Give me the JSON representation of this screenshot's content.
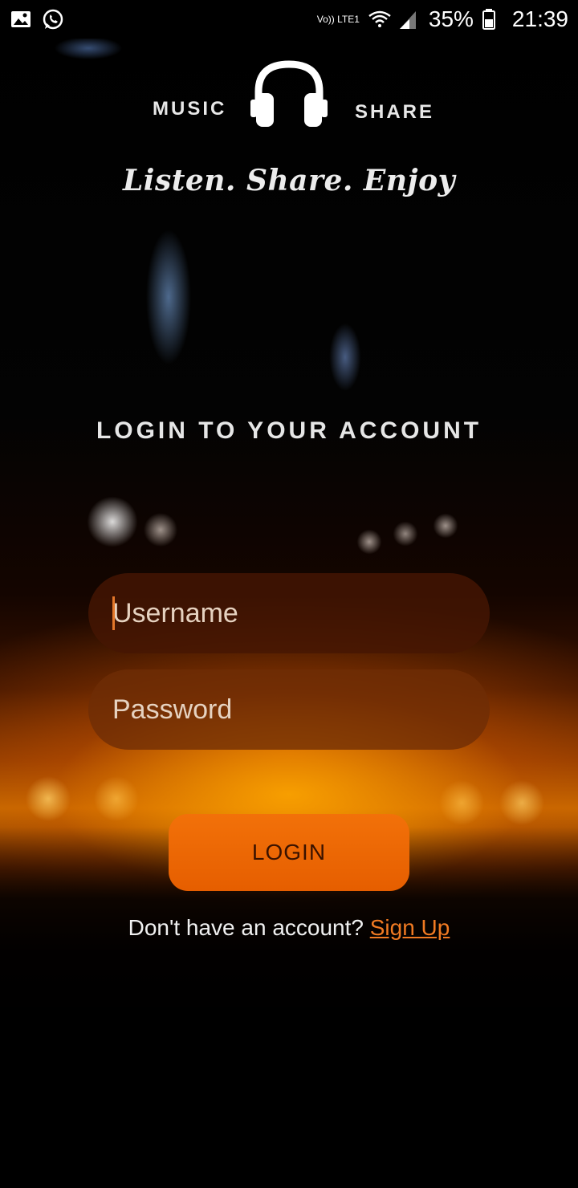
{
  "status_bar": {
    "volte_label": "Vo)) LTE1",
    "battery": "35%",
    "time": "21:39",
    "icons": [
      "gallery-icon",
      "whatsapp-icon",
      "wifi-icon",
      "signal-icon",
      "battery-icon"
    ]
  },
  "logo": {
    "left_word": "MUSIC",
    "right_word": "SHARE",
    "icon": "headphones-icon"
  },
  "tagline": "Listen. Share. Enjoy",
  "login": {
    "heading": "LOGIN TO YOUR ACCOUNT",
    "username_placeholder": "Username",
    "password_placeholder": "Password",
    "button_label": "LOGIN",
    "signup_prompt": "Don't have an account?",
    "signup_link": "Sign Up"
  },
  "colors": {
    "accent": "#e86400",
    "link": "#f07a22"
  }
}
